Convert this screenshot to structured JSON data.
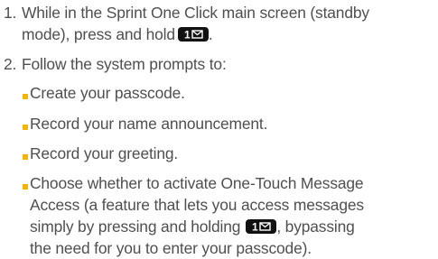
{
  "steps": [
    {
      "number": "1.",
      "lines": [
        "While in the Sprint One Click main screen (standby",
        "mode), press and hold"
      ],
      "line_end": "."
    },
    {
      "number": "2.",
      "lines": [
        "Follow the system prompts to:"
      ]
    }
  ],
  "bullets": [
    {
      "lines": [
        "Create your passcode."
      ]
    },
    {
      "lines": [
        "Record your name announcement."
      ]
    },
    {
      "lines": [
        "Record your greeting."
      ]
    },
    {
      "lines": [
        "Choose whether to activate One-Touch Message",
        "Access (a feature that lets you access messages",
        "simply by pressing and holding",
        ", bypassing",
        "the need for you to enter your passcode)."
      ]
    }
  ],
  "icons": {
    "key_glyph": "1-mail-key-icon",
    "bullet_color": "#f2b400",
    "text_color": "#4f4f4f"
  }
}
